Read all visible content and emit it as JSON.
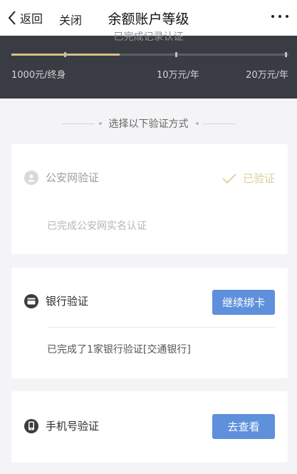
{
  "nav": {
    "back_label": "返回",
    "close_label": "关闭",
    "title": "余额账户等级"
  },
  "levels": {
    "clipped_text": "已完成记录认证",
    "progress": 0.39,
    "tiers": [
      {
        "label": "1000元/终身"
      },
      {
        "label": "10万元/年"
      },
      {
        "label": "20万元/年"
      }
    ],
    "accent_color": "#d7c084"
  },
  "section": {
    "heading": "选择以下验证方式"
  },
  "cards": {
    "police": {
      "title": "公安网验证",
      "status": "已验证",
      "description": "已完成公安网实名认证"
    },
    "bank": {
      "title": "银行验证",
      "button": "继续绑卡",
      "description": "已完成了1家银行验证[交通银行]"
    },
    "phone": {
      "title": "手机号验证",
      "button": "去查看"
    }
  },
  "colors": {
    "button_blue": "#5e90dc",
    "verified_gold": "#dccf95",
    "band_dark": "#3a3c44"
  },
  "icons": {
    "back": "chevron-left-icon",
    "more": "more-horizontal-icon",
    "police": "user-icon",
    "bank": "bank-card-icon",
    "phone": "phone-icon",
    "verified": "checkmark-icon"
  }
}
